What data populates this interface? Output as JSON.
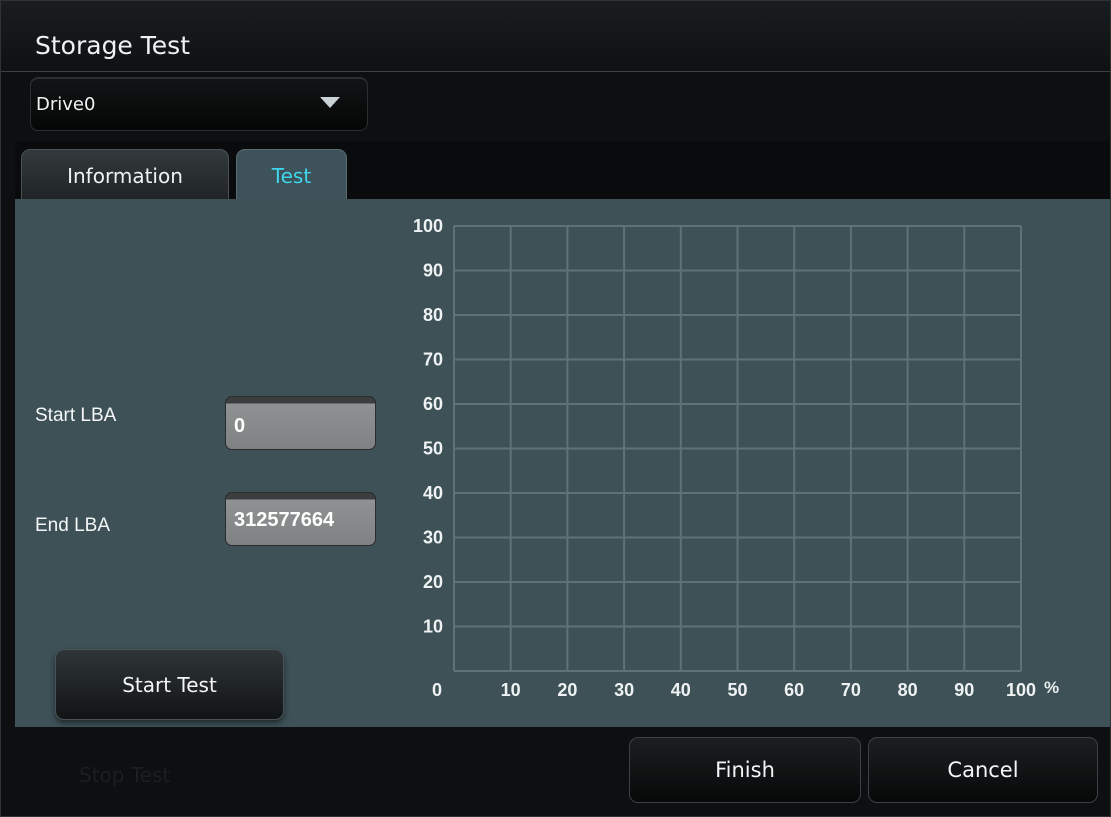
{
  "window": {
    "title": "Storage Test"
  },
  "drive_select": {
    "value": "Drive0",
    "icon": "chevron-down-icon"
  },
  "tabs": [
    {
      "label": "Information",
      "active": false
    },
    {
      "label": "Test",
      "active": true
    }
  ],
  "test_panel": {
    "start_lba": {
      "label": "Start LBA",
      "value": "0"
    },
    "end_lba": {
      "label": "End LBA",
      "value": "312577664"
    },
    "start_button_label": "Start Test",
    "stop_button_label": "Stop Test"
  },
  "chart_data": {
    "type": "line",
    "series": [],
    "x_ticks": [
      "0",
      "10",
      "20",
      "30",
      "40",
      "50",
      "60",
      "70",
      "80",
      "90",
      "100"
    ],
    "y_ticks": [
      "100",
      "90",
      "80",
      "70",
      "60",
      "50",
      "40",
      "30",
      "20",
      "10"
    ],
    "x_unit": "%",
    "xlim": [
      0,
      100
    ],
    "ylim": [
      0,
      100
    ],
    "grid": true
  },
  "footer": {
    "finish_label": "Finish",
    "cancel_label": "Cancel"
  },
  "colors": {
    "panel_bg": "#3d5157",
    "grid_line": "#5f7377",
    "active_tab_text": "#3fd5ee"
  }
}
